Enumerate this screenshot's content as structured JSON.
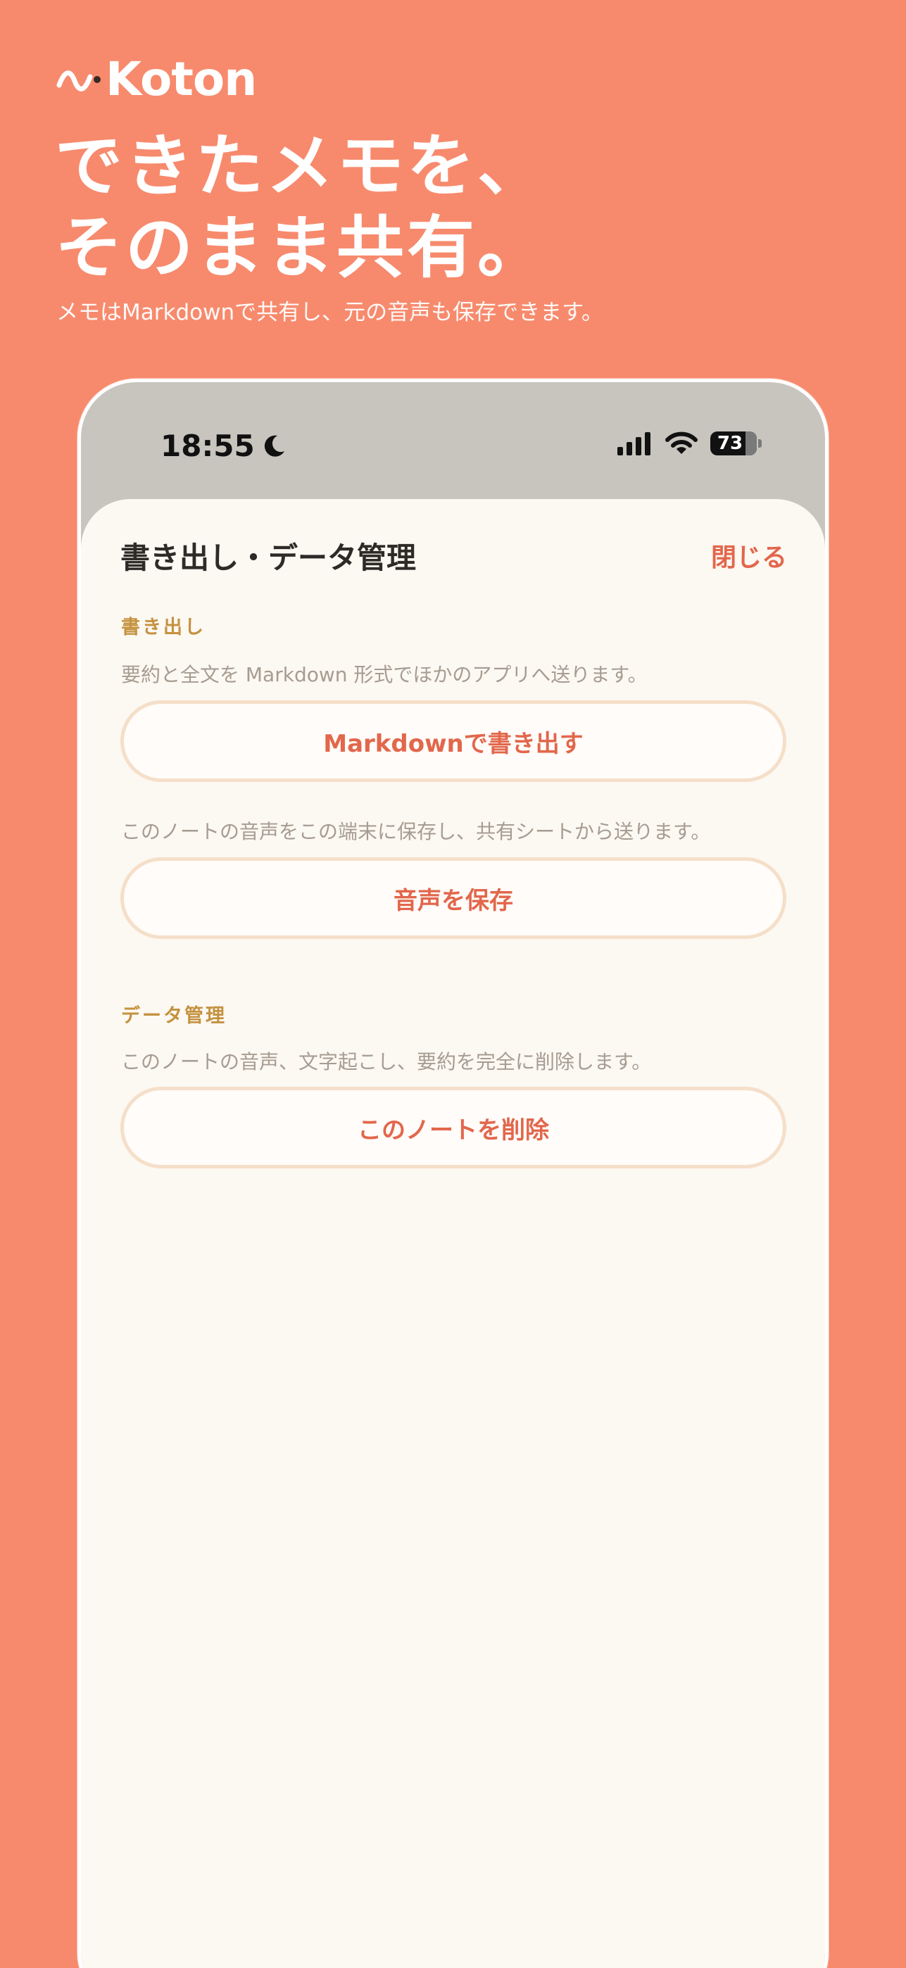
{
  "brand": {
    "name": "Koton"
  },
  "headline": {
    "line1": "できたメモを、",
    "line2": "そのまま共有。"
  },
  "subline": "メモはMarkdownで共有し、元の音声も保存できます。",
  "status_bar": {
    "time": "18:55",
    "battery": "73"
  },
  "sheet": {
    "title": "書き出し・データ管理",
    "close_label": "閉じる",
    "export_section": {
      "label": "書き出し",
      "markdown_desc": "要約と全文を Markdown 形式でほかのアプリへ送ります。",
      "markdown_button": "Markdownで書き出す",
      "audio_desc": "このノートの音声をこの端末に保存し、共有シートから送ります。",
      "audio_button": "音声を保存"
    },
    "data_section": {
      "label": "データ管理",
      "delete_desc": "このノートの音声、文字起こし、要約を完全に削除します。",
      "delete_button": "このノートを削除"
    }
  },
  "colors": {
    "background": "#F78A6D",
    "sheet": "#FCF8F2",
    "accent": "#E2674C",
    "section_label": "#C4923F",
    "muted_text": "#A69C91",
    "button_border": "#F5DFC9"
  },
  "icons": {
    "brand": "wave-logo-icon",
    "moon": "moon-icon",
    "signal": "cellular-signal-icon",
    "wifi": "wifi-icon",
    "battery": "battery-icon"
  }
}
